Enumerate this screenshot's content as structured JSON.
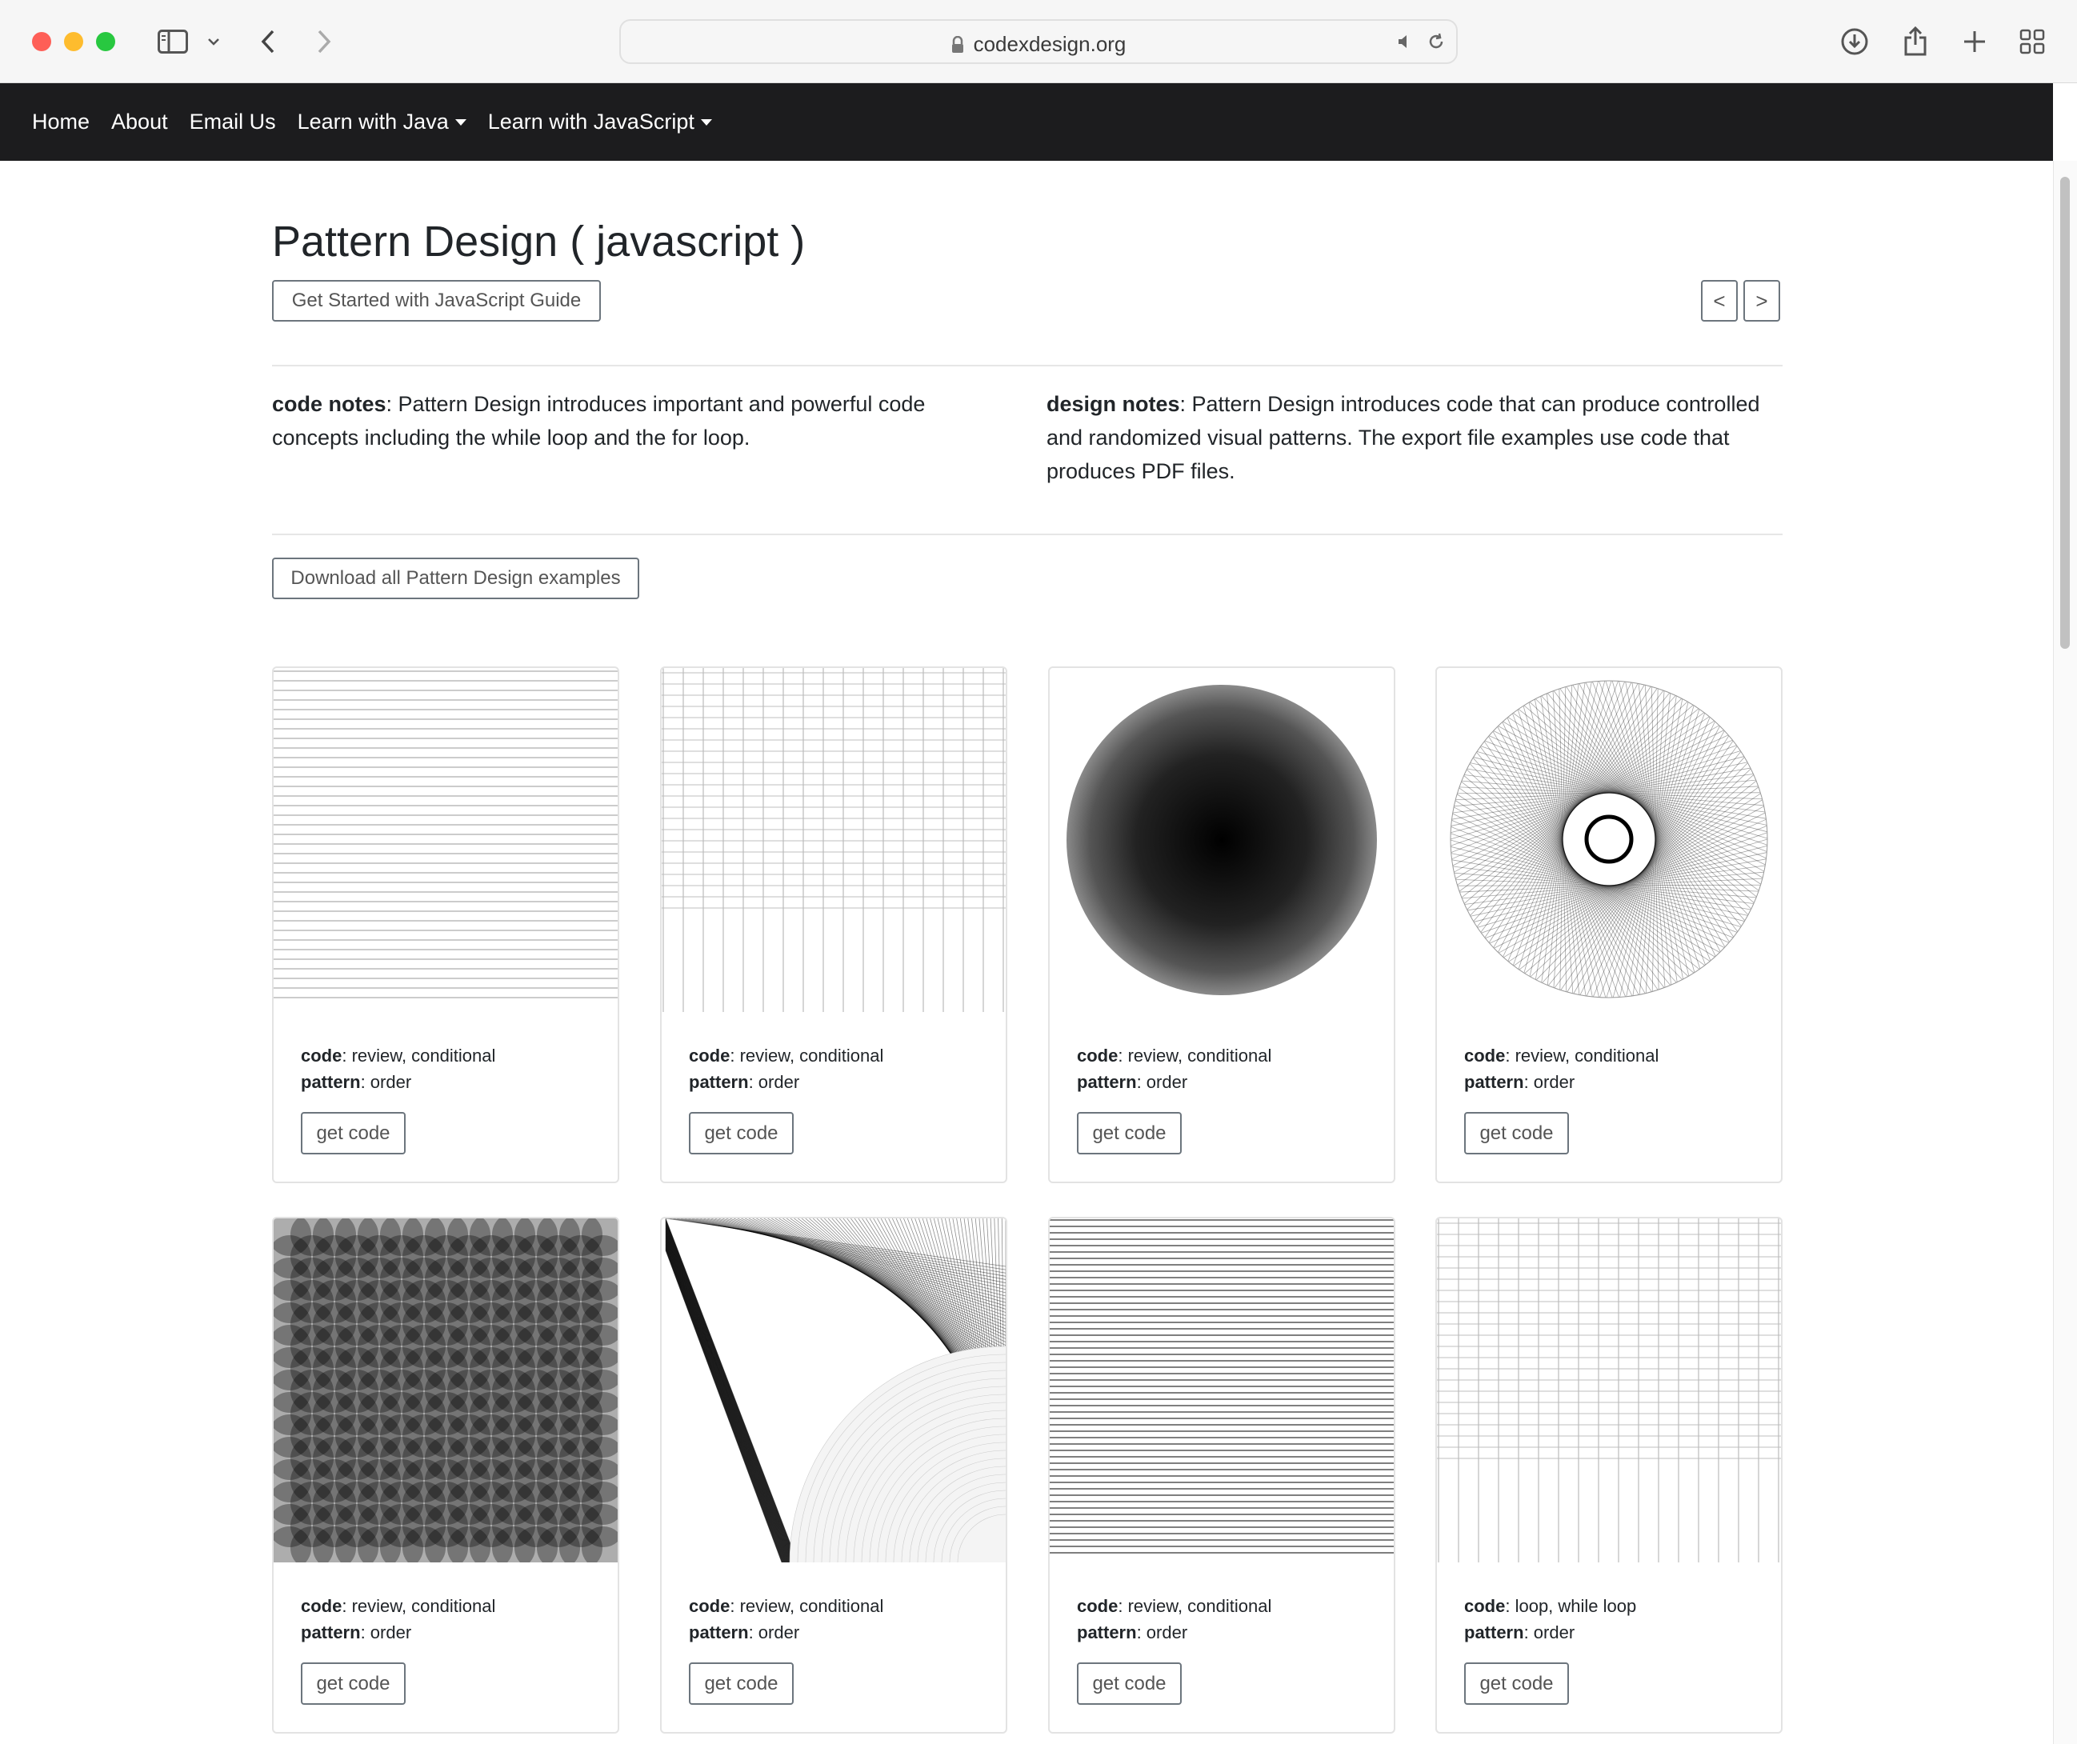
{
  "browser": {
    "url": "codexdesign.org",
    "icons": {
      "sidebar": "sidebar-icon",
      "chevron": "chevron-down-icon",
      "back": "back-arrow-icon",
      "forward": "forward-arrow-icon",
      "lock": "lock-icon",
      "sound": "speaker-icon",
      "reload": "reload-icon",
      "download": "download-icon",
      "share": "share-icon",
      "new_tab": "plus-icon",
      "tab_overview": "grid-icon"
    }
  },
  "nav": {
    "home": "Home",
    "about": "About",
    "email": "Email Us",
    "java": "Learn with Java",
    "javascript": "Learn with JavaScript"
  },
  "page": {
    "title": "Pattern Design ( javascript )",
    "guide_button": "Get Started with JavaScript Guide",
    "prev_button": "<",
    "next_button": ">",
    "code_notes_label": "code notes",
    "code_notes_text": ": Pattern Design introduces important and powerful code concepts including the while loop and the for loop.",
    "design_notes_label": "design notes",
    "design_notes_text": ": Pattern Design introduces code that can produce controlled and randomized visual patterns. The export file examples use code that produces PDF files.",
    "download_button": "Download all Pattern Design examples"
  },
  "cards": [
    {
      "code_label": "code",
      "code": ": review, conditional",
      "pattern_label": "pattern",
      "pattern": ": order",
      "button": "get code"
    },
    {
      "code_label": "code",
      "code": ": review, conditional",
      "pattern_label": "pattern",
      "pattern": ": order",
      "button": "get code"
    },
    {
      "code_label": "code",
      "code": ": review, conditional",
      "pattern_label": "pattern",
      "pattern": ": order",
      "button": "get code"
    },
    {
      "code_label": "code",
      "code": ": review, conditional",
      "pattern_label": "pattern",
      "pattern": ": order",
      "button": "get code"
    },
    {
      "code_label": "code",
      "code": ": review, conditional",
      "pattern_label": "pattern",
      "pattern": ": order",
      "button": "get code"
    },
    {
      "code_label": "code",
      "code": ": review, conditional",
      "pattern_label": "pattern",
      "pattern": ": order",
      "button": "get code"
    },
    {
      "code_label": "code",
      "code": ": review, conditional",
      "pattern_label": "pattern",
      "pattern": ": order",
      "button": "get code"
    },
    {
      "code_label": "code",
      "code": ": loop, while loop",
      "pattern_label": "pattern",
      "pattern": ": order",
      "button": "get code"
    }
  ]
}
